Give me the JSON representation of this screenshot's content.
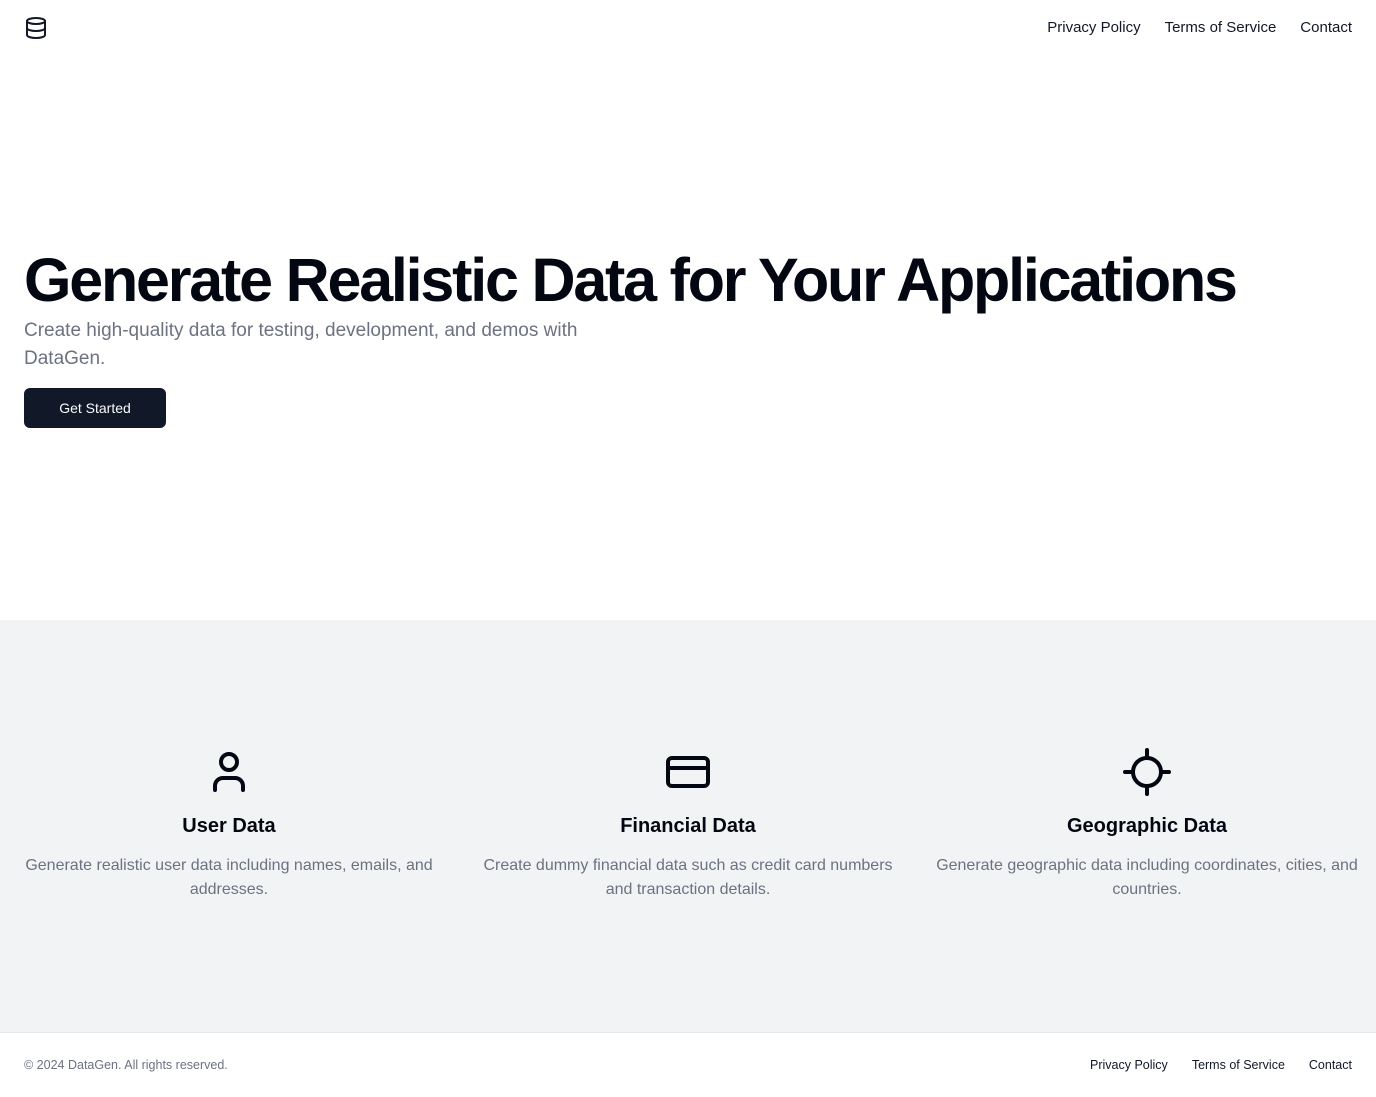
{
  "header": {
    "logo_icon": "database-icon",
    "nav": [
      {
        "label": "Privacy Policy"
      },
      {
        "label": "Terms of Service"
      },
      {
        "label": "Contact"
      }
    ]
  },
  "hero": {
    "title": "Generate Realistic Data for Your Applications",
    "subtitle": "Create high-quality data for testing, development, and demos with DataGen.",
    "cta_label": "Get Started"
  },
  "features": [
    {
      "icon": "user-icon",
      "title": "User Data",
      "description": "Generate realistic user data including names, emails, and addresses."
    },
    {
      "icon": "credit-card-icon",
      "title": "Financial Data",
      "description": "Create dummy financial data such as credit card numbers and transaction details."
    },
    {
      "icon": "crosshair-icon",
      "title": "Geographic Data",
      "description": "Generate geographic data including coordinates, cities, and countries."
    }
  ],
  "footer": {
    "copyright": "© 2024 DataGen. All rights reserved.",
    "nav": [
      {
        "label": "Privacy Policy"
      },
      {
        "label": "Terms of Service"
      },
      {
        "label": "Contact"
      }
    ]
  },
  "colors": {
    "primary_button": "#111827",
    "features_background": "#f2f3f5",
    "muted_text": "#6b7280"
  }
}
